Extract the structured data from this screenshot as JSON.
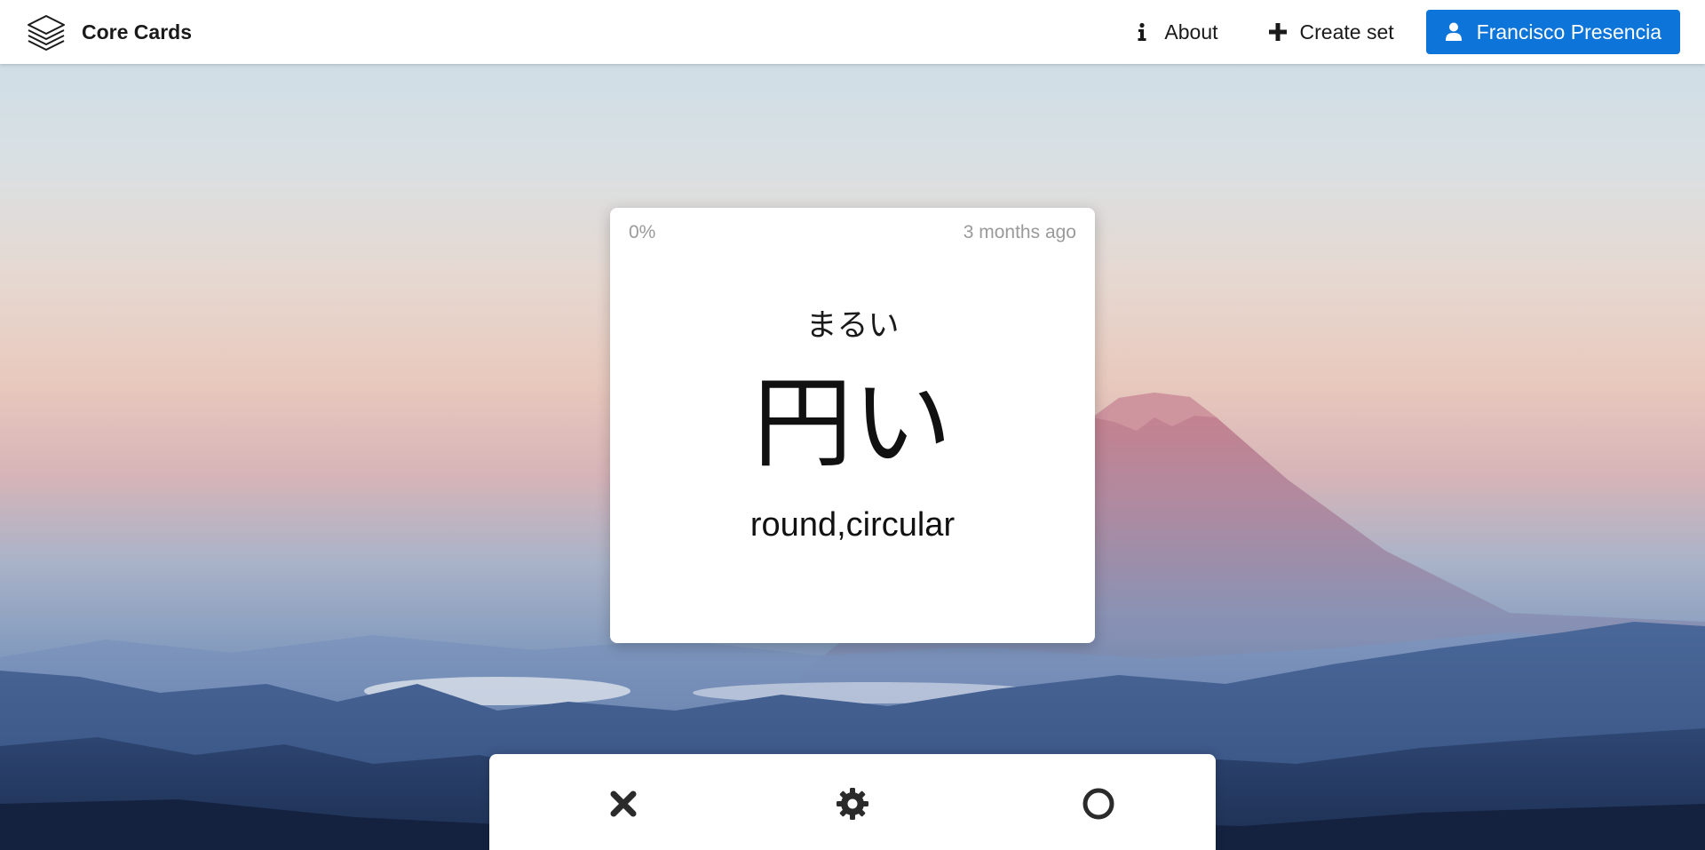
{
  "app": {
    "name": "Core Cards"
  },
  "nav": {
    "about_label": "About",
    "create_label": "Create set",
    "user_label": "Francisco Presencia"
  },
  "card": {
    "progress": "0%",
    "last_seen": "3 months ago",
    "reading": "まるい",
    "word": "円い",
    "meaning": "round,circular"
  },
  "answer_bar": {
    "wrong_icon": "cross-icon",
    "settings_icon": "gear-icon",
    "right_icon": "circle-icon"
  },
  "colors": {
    "primary": "#0d74d9",
    "text": "#1a1a1a",
    "muted": "#9a9a9a"
  }
}
